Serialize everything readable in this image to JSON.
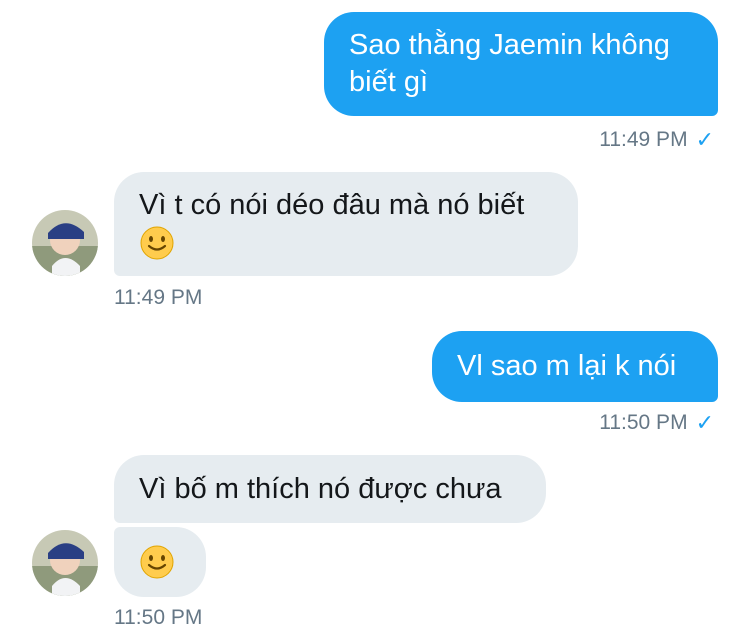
{
  "messages": [
    {
      "direction": "out",
      "text": "Sao thằng Jaemin không biết gì",
      "time": "11:49 PM"
    },
    {
      "direction": "in",
      "text": "Vì t có nói déo đâu mà nó biết",
      "emoji": "slightly-smiling-face",
      "time": "11:49 PM"
    },
    {
      "direction": "out",
      "text": "Vl sao m lại k nói",
      "time": "11:50 PM"
    },
    {
      "direction": "in",
      "text": "Vì bố m thích nó được chưa",
      "time": null
    },
    {
      "direction": "in",
      "emoji": "slightly-smiling-face",
      "time": "11:50 PM"
    }
  ],
  "colors": {
    "outgoing_bubble": "#1da1f2",
    "incoming_bubble": "#e6ecf0",
    "timestamp": "#657786",
    "read_check": "#1da1f2"
  },
  "icons": {
    "read_receipt": "checkmark-icon",
    "emoji": "slightly-smiling-face-emoji"
  }
}
